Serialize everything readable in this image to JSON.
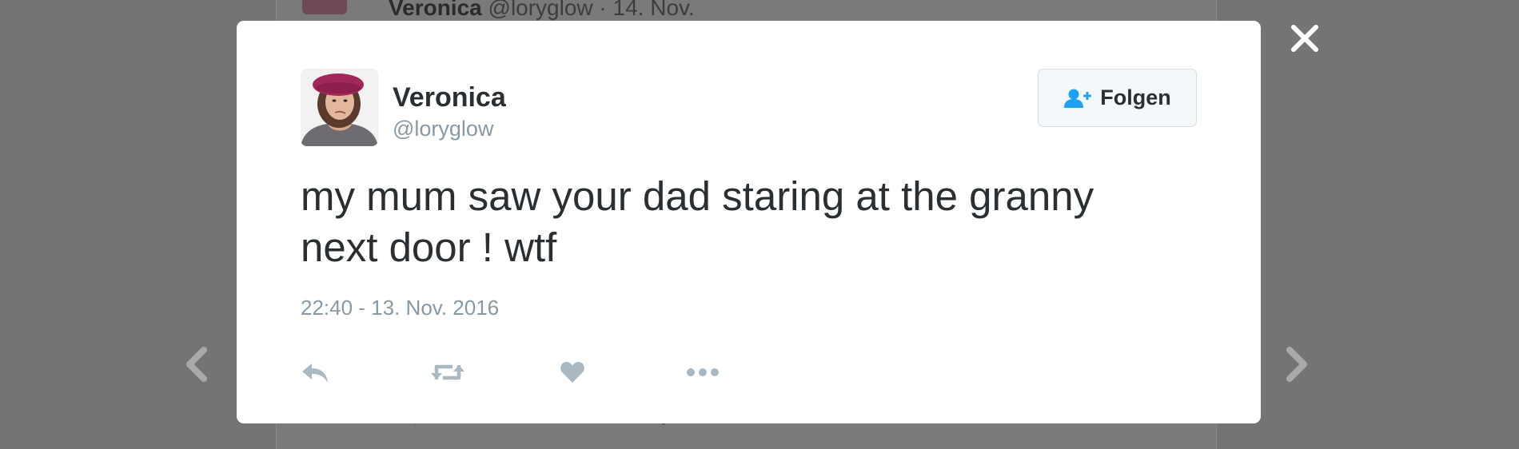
{
  "background_tweet": {
    "name": "Veronica",
    "meta": "@loryglow · 14. Nov."
  },
  "tweet": {
    "author_name": "Veronica",
    "author_handle": "@loryglow",
    "follow_label": "Folgen",
    "text": "my mum saw your dad staring at the granny next door ! wtf",
    "timestamp": "22:40 - 13. Nov. 2016"
  },
  "icons": {
    "close": "close-icon",
    "prev": "chevron-left-icon",
    "next": "chevron-right-icon",
    "follow": "add-user-icon",
    "reply": "reply-icon",
    "retweet": "retweet-icon",
    "like": "heart-icon",
    "more": "more-icon"
  },
  "colors": {
    "overlay": "#747474",
    "text": "#292f33",
    "muted": "#8899a6",
    "accent": "#1da1f2",
    "action_icon": "#aab8c2"
  }
}
